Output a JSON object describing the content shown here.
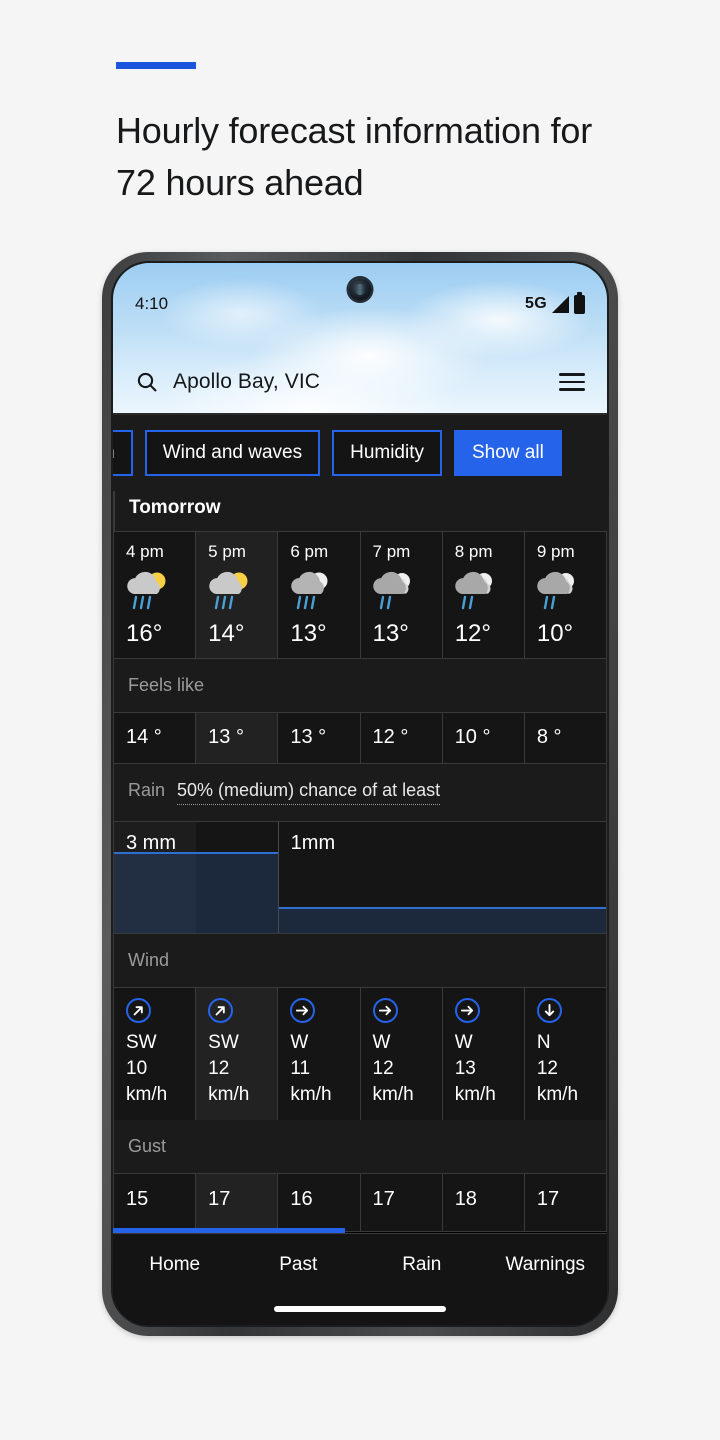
{
  "page": {
    "title": "Hourly forecast information for 72 hours ahead",
    "accent_color": "#1a56db"
  },
  "phone": {
    "status": {
      "time": "4:10",
      "network": "5G",
      "signal_icon": "signal-bars-icon",
      "battery_icon": "battery-icon",
      "camera_icon": "front-camera-icon"
    },
    "search": {
      "icon": "search-icon",
      "location": "Apollo Bay, VIC",
      "menu_icon": "hamburger-menu-icon"
    }
  },
  "chips": [
    {
      "label": "rain",
      "style": "outline",
      "cut_off": true
    },
    {
      "label": "Wind and waves",
      "style": "outline",
      "cut_off": false
    },
    {
      "label": "Humidity",
      "style": "outline",
      "cut_off": false
    },
    {
      "label": "Show all",
      "style": "solid",
      "cut_off": false
    }
  ],
  "day_label": "Tomorrow",
  "hours": [
    {
      "time": "4 pm",
      "icon": "sun-cloud-rain-icon",
      "temp": "16°",
      "feels_like": "14 °",
      "wind_dir": "SW",
      "wind_speed": "10",
      "wind_unit": "km/h",
      "wind_arrow_deg": 45,
      "gust": "15"
    },
    {
      "time": "5 pm",
      "icon": "sun-cloud-rain-icon",
      "temp": "14°",
      "feels_like": "13 °",
      "wind_dir": "SW",
      "wind_speed": "12",
      "wind_unit": "km/h",
      "wind_arrow_deg": 45,
      "gust": "17"
    },
    {
      "time": "6 pm",
      "icon": "moon-cloud-rain-icon",
      "temp": "13°",
      "feels_like": "13 °",
      "wind_dir": "W",
      "wind_speed": "11",
      "wind_unit": "km/h",
      "wind_arrow_deg": 90,
      "gust": "16"
    },
    {
      "time": "7 pm",
      "icon": "moon-cloud-rain-icon",
      "temp": "13°",
      "feels_like": "12 °",
      "wind_dir": "W",
      "wind_speed": "12",
      "wind_unit": "km/h",
      "wind_arrow_deg": 90,
      "gust": "17"
    },
    {
      "time": "8 pm",
      "icon": "moon-cloud-rain-icon",
      "temp": "12°",
      "feels_like": "10 °",
      "wind_dir": "W",
      "wind_speed": "13",
      "wind_unit": "km/h",
      "wind_arrow_deg": 90,
      "gust": "18"
    },
    {
      "time": "9 pm",
      "icon": "moon-cloud-rain-icon",
      "temp": "10°",
      "feels_like": "8 °",
      "wind_dir": "N",
      "wind_speed": "12",
      "wind_unit": "km/h",
      "wind_arrow_deg": 180,
      "gust": "17"
    }
  ],
  "sections": {
    "feels_like": {
      "label": "Feels like"
    },
    "rain": {
      "label": "Rain",
      "sub": "50% (medium) chance of at least",
      "blocks": [
        {
          "label": "3 mm",
          "span": 2,
          "fill_pct": 73
        },
        {
          "label": "1mm",
          "span": 4,
          "fill_pct": 23
        }
      ]
    },
    "wind": {
      "label": "Wind"
    },
    "gust": {
      "label": "Gust"
    }
  },
  "scroll": {
    "indicator_pct": 47,
    "color": "#2563eb"
  },
  "bottom_nav": [
    {
      "label": "Home"
    },
    {
      "label": "Past"
    },
    {
      "label": "Rain"
    },
    {
      "label": "Warnings"
    }
  ],
  "colors": {
    "accent": "#2563eb",
    "app_bg": "#000000",
    "row_bg": "#151515",
    "row_alt_bg": "#222222"
  }
}
